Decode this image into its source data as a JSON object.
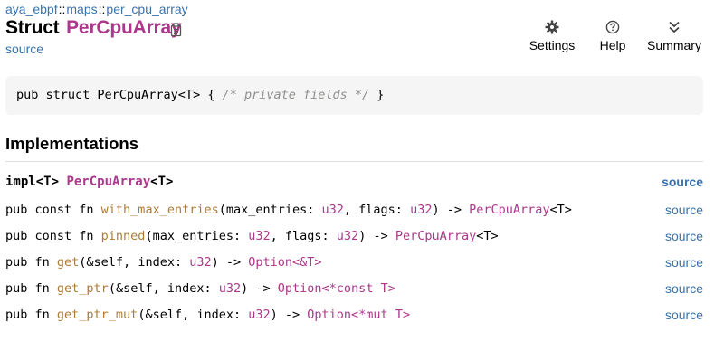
{
  "breadcrumb": {
    "parts": [
      "aya_ebpf",
      "maps",
      "per_cpu_array"
    ],
    "separator": "::"
  },
  "title": {
    "kind": "Struct",
    "name": "PerCpuArray"
  },
  "source_link": "source",
  "toolbar": {
    "settings": {
      "label": "Settings",
      "icon": "gear-icon"
    },
    "help": {
      "label": "Help",
      "icon": "question-circle-icon"
    },
    "summary": {
      "label": "Summary",
      "icon": "double-chevron-down-icon"
    }
  },
  "declaration": {
    "prefix": "pub struct PerCpuArray<T> { ",
    "comment": "/* private fields */",
    "suffix": " }"
  },
  "implementations": {
    "heading": "Implementations",
    "impl_line": {
      "prefix": "impl<T> ",
      "type": "PerCpuArray",
      "suffix": "<T>",
      "source": "source"
    },
    "methods": [
      {
        "prefix": "pub const fn ",
        "name": "with_max_entries",
        "args1": "(max_entries: ",
        "type1": "u32",
        "args2": ", flags: ",
        "type2": "u32",
        "args3": ") -> ",
        "ret": "PerCpuArray",
        "ret_suffix": "<T>",
        "source": "source"
      },
      {
        "prefix": "pub const fn ",
        "name": "pinned",
        "args1": "(max_entries: ",
        "type1": "u32",
        "args2": ", flags: ",
        "type2": "u32",
        "args3": ") -> ",
        "ret": "PerCpuArray",
        "ret_suffix": "<T>",
        "source": "source"
      },
      {
        "prefix": "pub fn ",
        "name": "get",
        "args1": "(&self, index: ",
        "type1": "u32",
        "args3": ") -> ",
        "ret": "Option",
        "ret_suffix": "<&T>",
        "source": "source"
      },
      {
        "prefix": "pub fn ",
        "name": "get_ptr",
        "args1": "(&self, index: ",
        "type1": "u32",
        "args3": ") -> ",
        "ret": "Option",
        "ret_suffix": "<*const T>",
        "source": "source"
      },
      {
        "prefix": "pub fn ",
        "name": "get_ptr_mut",
        "args1": "(&self, index: ",
        "type1": "u32",
        "args3": ") -> ",
        "ret": "Option",
        "ret_suffix": "<*mut T>",
        "source": "source"
      }
    ]
  },
  "colors": {
    "link": "#3873ad",
    "struct": "#ad378a",
    "fn": "#ad7c37",
    "comment": "#8e908c",
    "code_bg": "#f5f5f5"
  }
}
